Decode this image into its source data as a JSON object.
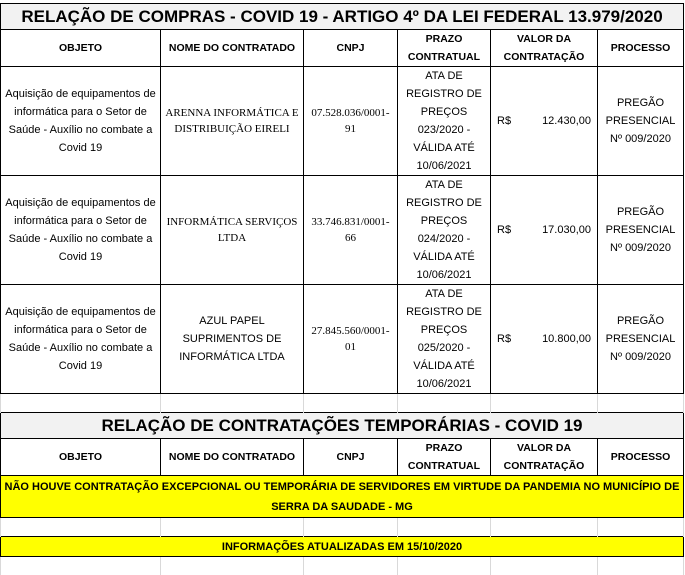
{
  "compras": {
    "title": "RELAÇÃO DE COMPRAS - COVID 19 - ARTIGO 4º DA LEI FEDERAL 13.979/2020",
    "headers": [
      "OBJETO",
      "NOME DO CONTRATADO",
      "CNPJ",
      "PRAZO CONTRATUAL",
      "VALOR DA CONTRATAÇÃO",
      "PROCESSO"
    ],
    "rows": [
      {
        "objeto": "Aquisição de equipamentos de informática para o Setor de Saúde - Auxílio no combate a Covid 19",
        "contratado": "ARENNA INFORMÁTICA E DISTRIBUIÇÃO EIRELI",
        "cnpj": "07.528.036/0001-91",
        "prazo": "ATA DE REGISTRO DE PREÇOS 023/2020 - VÁLIDA ATÉ 10/06/2021",
        "moeda": "R$",
        "valor": "12.430,00",
        "processo": "PREGÃO PRESENCIAL Nº 009/2020"
      },
      {
        "objeto": "Aquisição de equipamentos de informática para o Setor de Saúde - Auxílio no combate a Covid 19",
        "contratado": "INFORMÁTICA SERVIÇOS LTDA",
        "cnpj": "33.746.831/0001-66",
        "prazo": "ATA DE REGISTRO DE PREÇOS 024/2020 - VÁLIDA ATÉ 10/06/2021",
        "moeda": "R$",
        "valor": "17.030,00",
        "processo": "PREGÃO PRESENCIAL Nº 009/2020"
      },
      {
        "objeto": "Aquisição de equipamentos de informática para o Setor de Saúde - Auxílio no combate a Covid 19",
        "contratado": "AZUL PAPEL SUPRIMENTOS DE INFORMÁTICA LTDA",
        "cnpj": "27.845.560/0001-01",
        "prazo": "ATA DE REGISTRO DE PREÇOS 025/2020 - VÁLIDA ATÉ 10/06/2021",
        "moeda": "R$",
        "valor": "10.800,00",
        "processo": "PREGÃO PRESENCIAL Nº 009/2020"
      }
    ]
  },
  "temporarias": {
    "title": "RELAÇÃO DE CONTRATAÇÕES TEMPORÁRIAS - COVID 19",
    "headers": [
      "OBJETO",
      "NOME DO CONTRATADO",
      "CNPJ",
      "PRAZO CONTRATUAL",
      "VALOR DA CONTRATAÇÃO",
      "PROCESSO"
    ],
    "notice": "NÃO HOUVE CONTRATAÇÃO EXCEPCIONAL OU TEMPORÁRIA DE SERVIDORES EM VIRTUDE DA PANDEMIA NO MUNICÍPIO DE SERRA DA SAUDADE - MG"
  },
  "footer": {
    "updated": "INFORMAÇÕES ATUALIZADAS EM 15/10/2020"
  },
  "colors": {
    "highlight": "#ffff00",
    "title_bg": "#f2f2f2"
  }
}
